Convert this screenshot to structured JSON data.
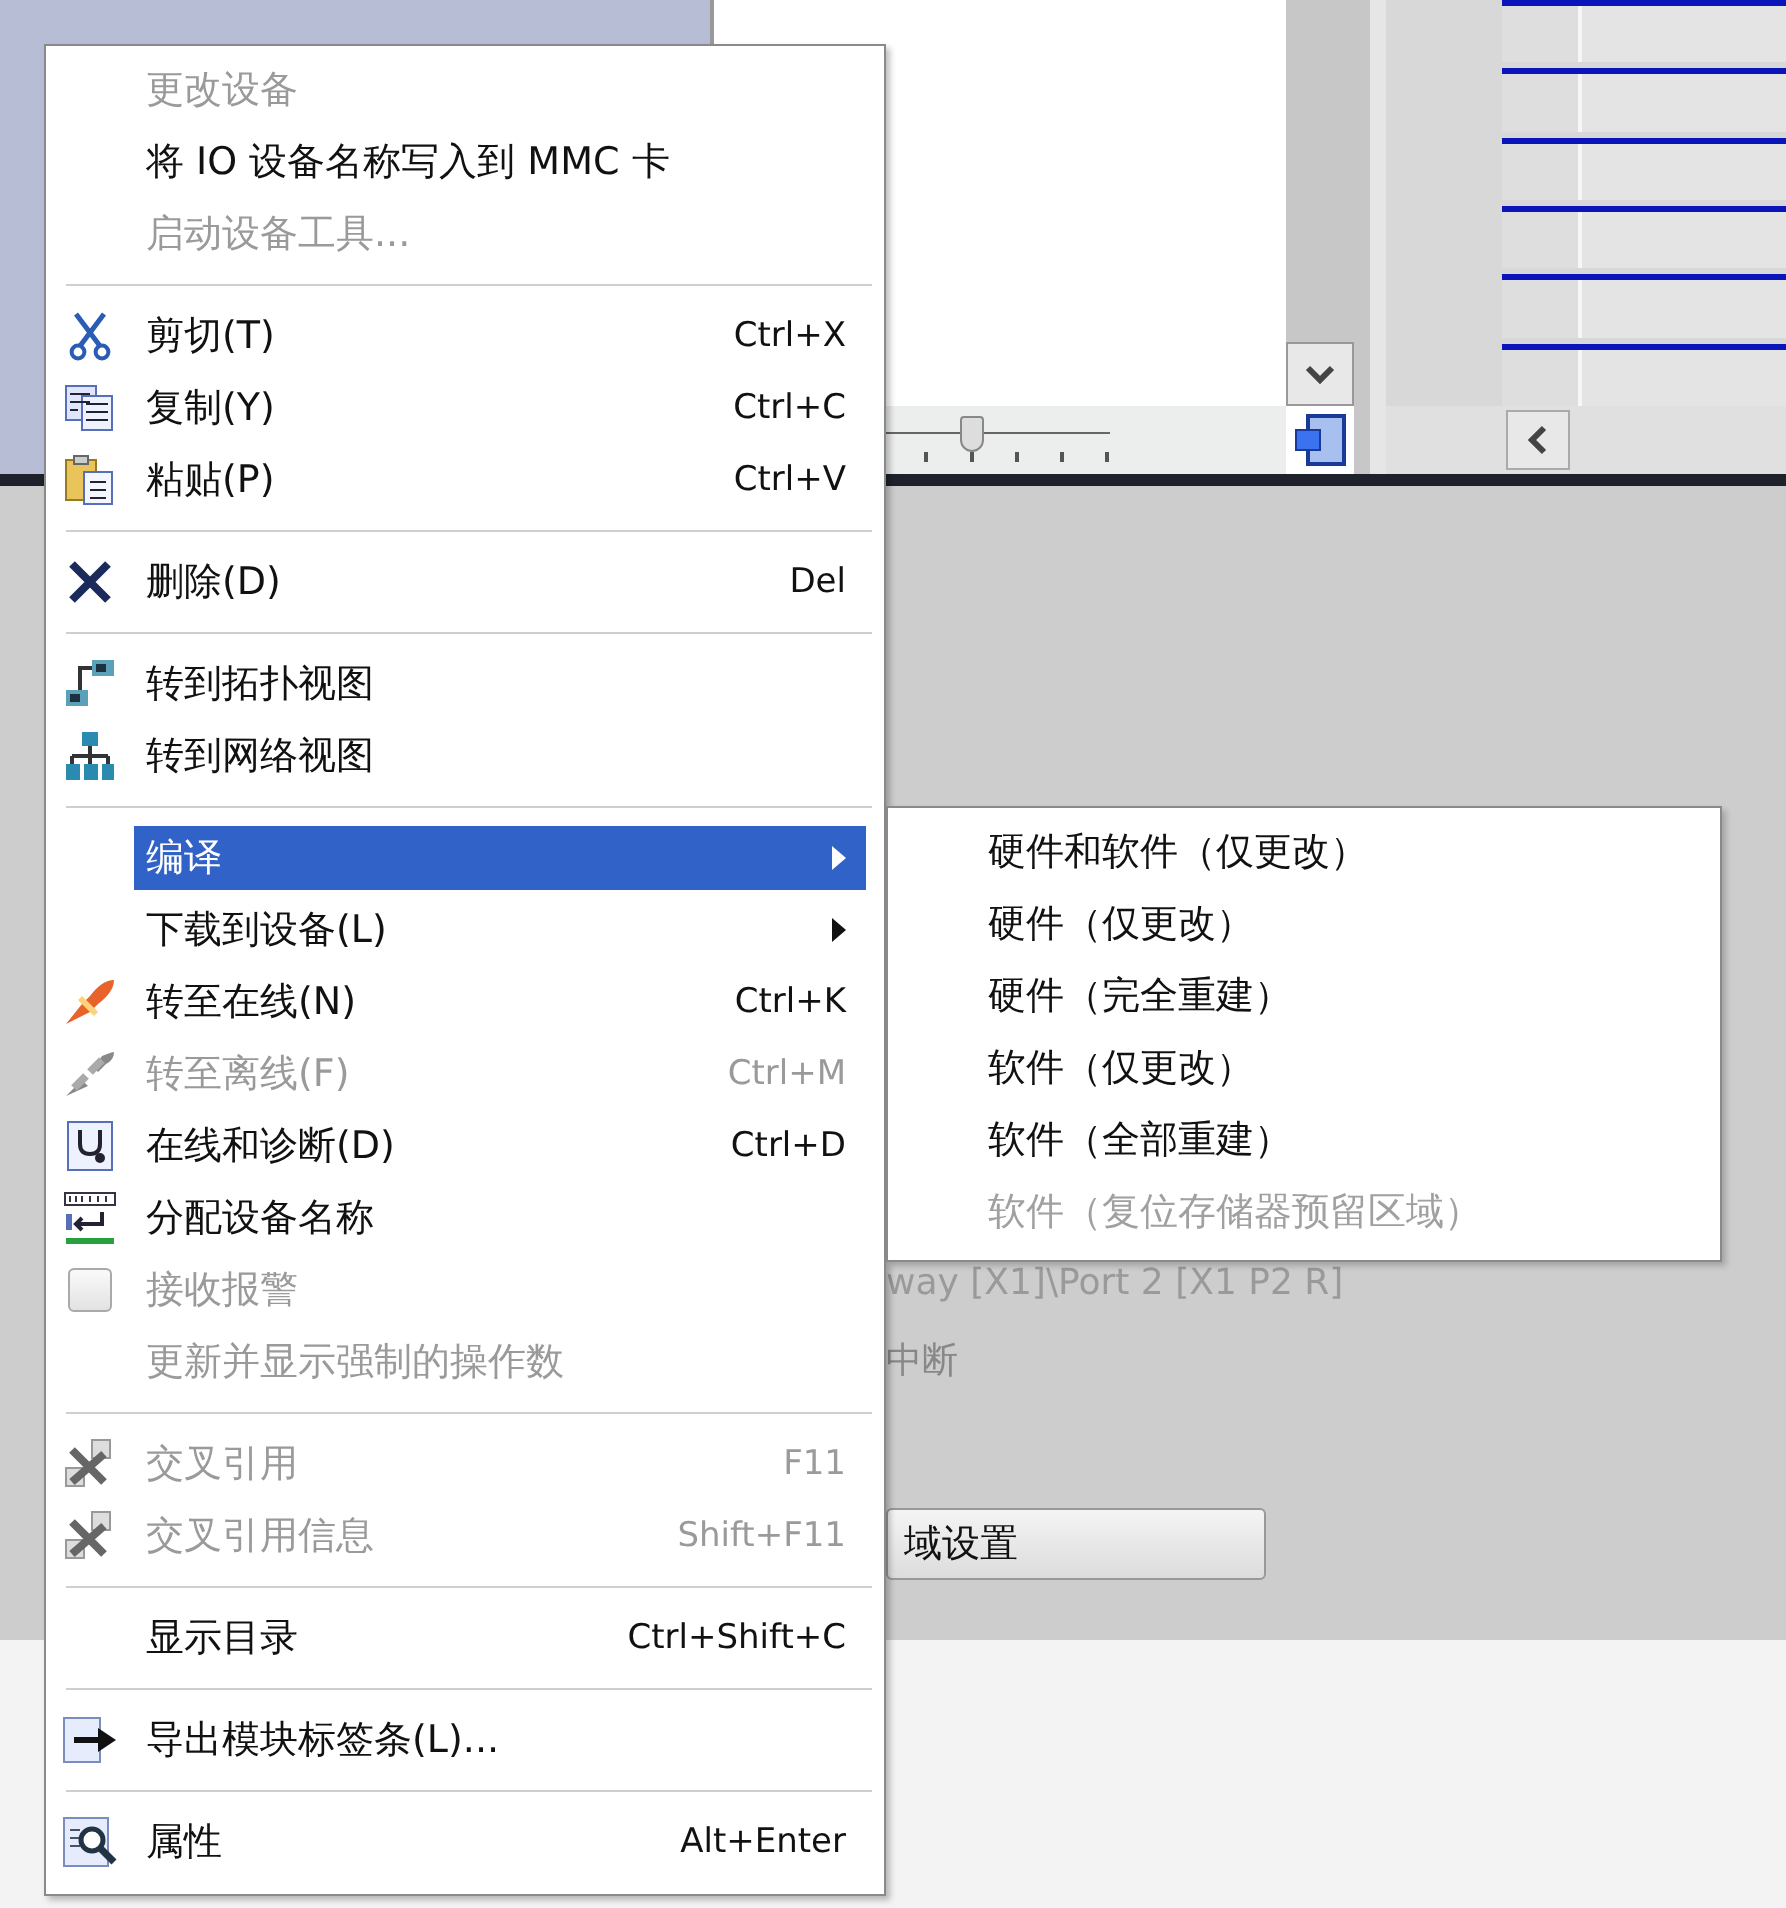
{
  "background": {
    "zoom_slider": {
      "level": 0.5
    },
    "port_text": "way [X1]\\Port 2 [X1 P2 R]",
    "status_text": "中断",
    "settings_button": "域设置"
  },
  "context_menu": {
    "groups": [
      [
        {
          "kind": "command",
          "label": "更改设备",
          "disabled": true,
          "selected": false
        },
        {
          "kind": "command",
          "label": "将 IO 设备名称写入到 MMC 卡",
          "disabled": false,
          "selected": false
        },
        {
          "kind": "command",
          "label": "启动设备工具...",
          "disabled": true,
          "selected": false
        }
      ],
      [
        {
          "kind": "command",
          "label": "剪切(T)",
          "shortcut": "Ctrl+X",
          "disabled": false,
          "selected": false
        },
        {
          "kind": "command",
          "label": "复制(Y)",
          "shortcut": "Ctrl+C",
          "disabled": false,
          "selected": false
        },
        {
          "kind": "command",
          "label": "粘贴(P)",
          "shortcut": "Ctrl+V",
          "disabled": false,
          "selected": false
        }
      ],
      [
        {
          "kind": "command",
          "label": "删除(D)",
          "shortcut": "Del",
          "disabled": false,
          "selected": false
        }
      ],
      [
        {
          "kind": "command",
          "label": "转到拓扑视图",
          "disabled": false,
          "selected": false
        },
        {
          "kind": "command",
          "label": "转到网络视图",
          "disabled": false,
          "selected": false
        }
      ],
      [
        {
          "kind": "submenu",
          "label": "编译",
          "disabled": false,
          "selected": true
        },
        {
          "kind": "submenu",
          "label": "下载到设备(L)",
          "disabled": false,
          "selected": false
        },
        {
          "kind": "command",
          "label": "转至在线(N)",
          "shortcut": "Ctrl+K",
          "disabled": false,
          "selected": false
        },
        {
          "kind": "command",
          "label": "转至离线(F)",
          "shortcut": "Ctrl+M",
          "disabled": true,
          "selected": false
        },
        {
          "kind": "command",
          "label": "在线和诊断(D)",
          "shortcut": "Ctrl+D",
          "disabled": false,
          "selected": false
        },
        {
          "kind": "command",
          "label": "分配设备名称",
          "disabled": false,
          "selected": false
        },
        {
          "kind": "checkbox",
          "label": "接收报警",
          "checked": false,
          "disabled": true,
          "selected": false
        },
        {
          "kind": "command",
          "label": "更新并显示强制的操作数",
          "disabled": true,
          "selected": false
        }
      ],
      [
        {
          "kind": "command",
          "label": "交叉引用",
          "shortcut": "F11",
          "disabled": true,
          "selected": false
        },
        {
          "kind": "command",
          "label": "交叉引用信息",
          "shortcut": "Shift+F11",
          "disabled": true,
          "selected": false
        }
      ],
      [
        {
          "kind": "command",
          "label": "显示目录",
          "shortcut": "Ctrl+Shift+C",
          "disabled": false,
          "selected": false
        }
      ],
      [
        {
          "kind": "command",
          "label": "导出模块标签条(L)...",
          "disabled": false,
          "selected": false
        }
      ],
      [
        {
          "kind": "command",
          "label": "属性",
          "shortcut": "Alt+Enter",
          "disabled": false,
          "selected": false
        }
      ]
    ]
  },
  "submenu": {
    "items": [
      {
        "label": "硬件和软件（仅更改）",
        "disabled": false
      },
      {
        "label": "硬件（仅更改）",
        "disabled": false
      },
      {
        "label": "硬件（完全重建）",
        "disabled": false
      },
      {
        "label": "软件（仅更改）",
        "disabled": false
      },
      {
        "label": "软件（全部重建）",
        "disabled": false
      },
      {
        "label": "软件（复位存储器预留区域）",
        "disabled": true
      }
    ]
  }
}
